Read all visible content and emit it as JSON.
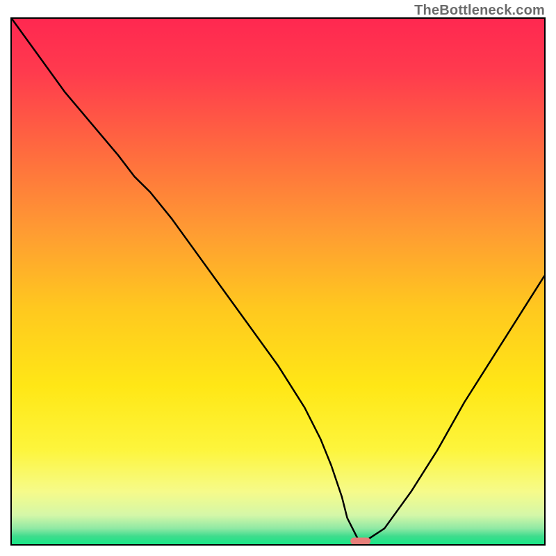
{
  "watermark": "TheBottleneck.com",
  "chart_data": {
    "type": "line",
    "title": "",
    "xlabel": "",
    "ylabel": "",
    "xlim": [
      0,
      100
    ],
    "ylim": [
      0,
      100
    ],
    "grid": false,
    "legend": false,
    "background_gradient_stops": [
      {
        "offset": 0.0,
        "color": "#ff2850"
      },
      {
        "offset": 0.1,
        "color": "#ff3a4e"
      },
      {
        "offset": 0.25,
        "color": "#ff6a3f"
      },
      {
        "offset": 0.4,
        "color": "#ff9a33"
      },
      {
        "offset": 0.55,
        "color": "#ffc81f"
      },
      {
        "offset": 0.7,
        "color": "#ffe716"
      },
      {
        "offset": 0.82,
        "color": "#fdf53c"
      },
      {
        "offset": 0.9,
        "color": "#f6fb8a"
      },
      {
        "offset": 0.945,
        "color": "#d4f7a8"
      },
      {
        "offset": 0.97,
        "color": "#8fe9a4"
      },
      {
        "offset": 0.985,
        "color": "#3fdc8d"
      },
      {
        "offset": 1.0,
        "color": "#17e686"
      }
    ],
    "series": [
      {
        "name": "bottleneck-curve",
        "x": [
          0,
          5,
          10,
          15,
          20,
          23,
          26,
          30,
          35,
          40,
          45,
          50,
          55,
          58,
          60,
          62,
          63,
          65,
          67,
          70,
          75,
          80,
          85,
          90,
          95,
          100
        ],
        "y": [
          100,
          93,
          86,
          80,
          74,
          70,
          67,
          62,
          55,
          48,
          41,
          34,
          26,
          20,
          15,
          9,
          5,
          1,
          1,
          3,
          10,
          18,
          27,
          35,
          43,
          51
        ]
      }
    ],
    "marker": {
      "name": "optimal-marker",
      "x": 65.5,
      "y": 0.6,
      "width_pct": 3.8,
      "height_pct": 1.3,
      "color": "#e77f7a"
    }
  }
}
